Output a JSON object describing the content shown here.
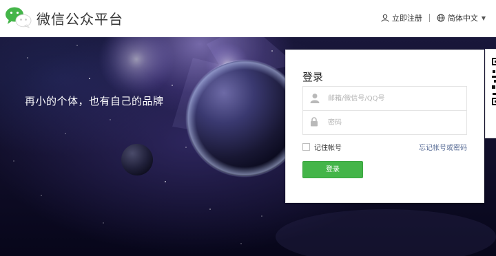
{
  "header": {
    "logo_text": "微信公众平台",
    "register_label": "立即注册",
    "language_label": "简体中文"
  },
  "banner": {
    "slogan": "再小的个体，也有自己的品牌"
  },
  "login": {
    "title": "登录",
    "account_placeholder": "邮箱/微信号/QQ号",
    "password_placeholder": "密码",
    "remember_label": "记住帐号",
    "forgot_label": "忘记帐号或密码",
    "submit_label": "登录"
  },
  "icons": {
    "logo": "wechat-logo-icon",
    "register": "user-icon",
    "language": "globe-icon",
    "account": "person-icon",
    "password": "lock-icon"
  },
  "colors": {
    "brand_green": "#44b549",
    "link_blue": "#576b95",
    "header_bg": "#ffffff"
  }
}
